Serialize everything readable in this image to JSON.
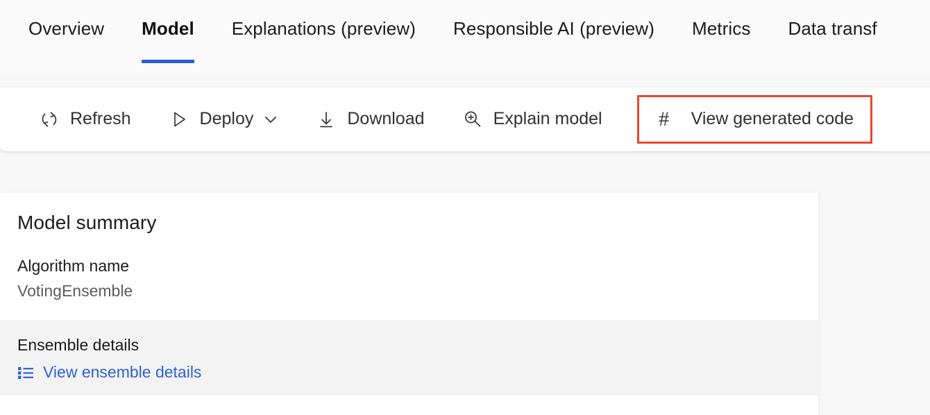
{
  "tabs": {
    "items": [
      {
        "label": "Overview",
        "active": false
      },
      {
        "label": "Model",
        "active": true
      },
      {
        "label": "Explanations (preview)",
        "active": false
      },
      {
        "label": "Responsible AI (preview)",
        "active": false
      },
      {
        "label": "Metrics",
        "active": false
      },
      {
        "label": "Data transf",
        "active": false
      }
    ]
  },
  "toolbar": {
    "refresh_label": "Refresh",
    "refresh_icon": "refresh-icon",
    "deploy_label": "Deploy",
    "deploy_icon": "play-triangle-icon",
    "deploy_chevron_icon": "chevron-down-icon",
    "download_label": "Download",
    "download_icon": "download-arrow-icon",
    "explain_label": "Explain model",
    "explain_icon": "magnifier-plus-icon",
    "view_code_label": "View generated code",
    "view_code_icon": "hash-icon",
    "view_code_symbol": "#",
    "highlight_color": "#e8472e"
  },
  "card": {
    "title": "Model summary",
    "algorithm_label": "Algorithm name",
    "algorithm_value": "VotingEnsemble",
    "ensemble_label": "Ensemble details",
    "ensemble_link_label": "View ensemble details",
    "ensemble_link_icon": "bulleted-list-icon",
    "link_color": "#2f61d5"
  }
}
